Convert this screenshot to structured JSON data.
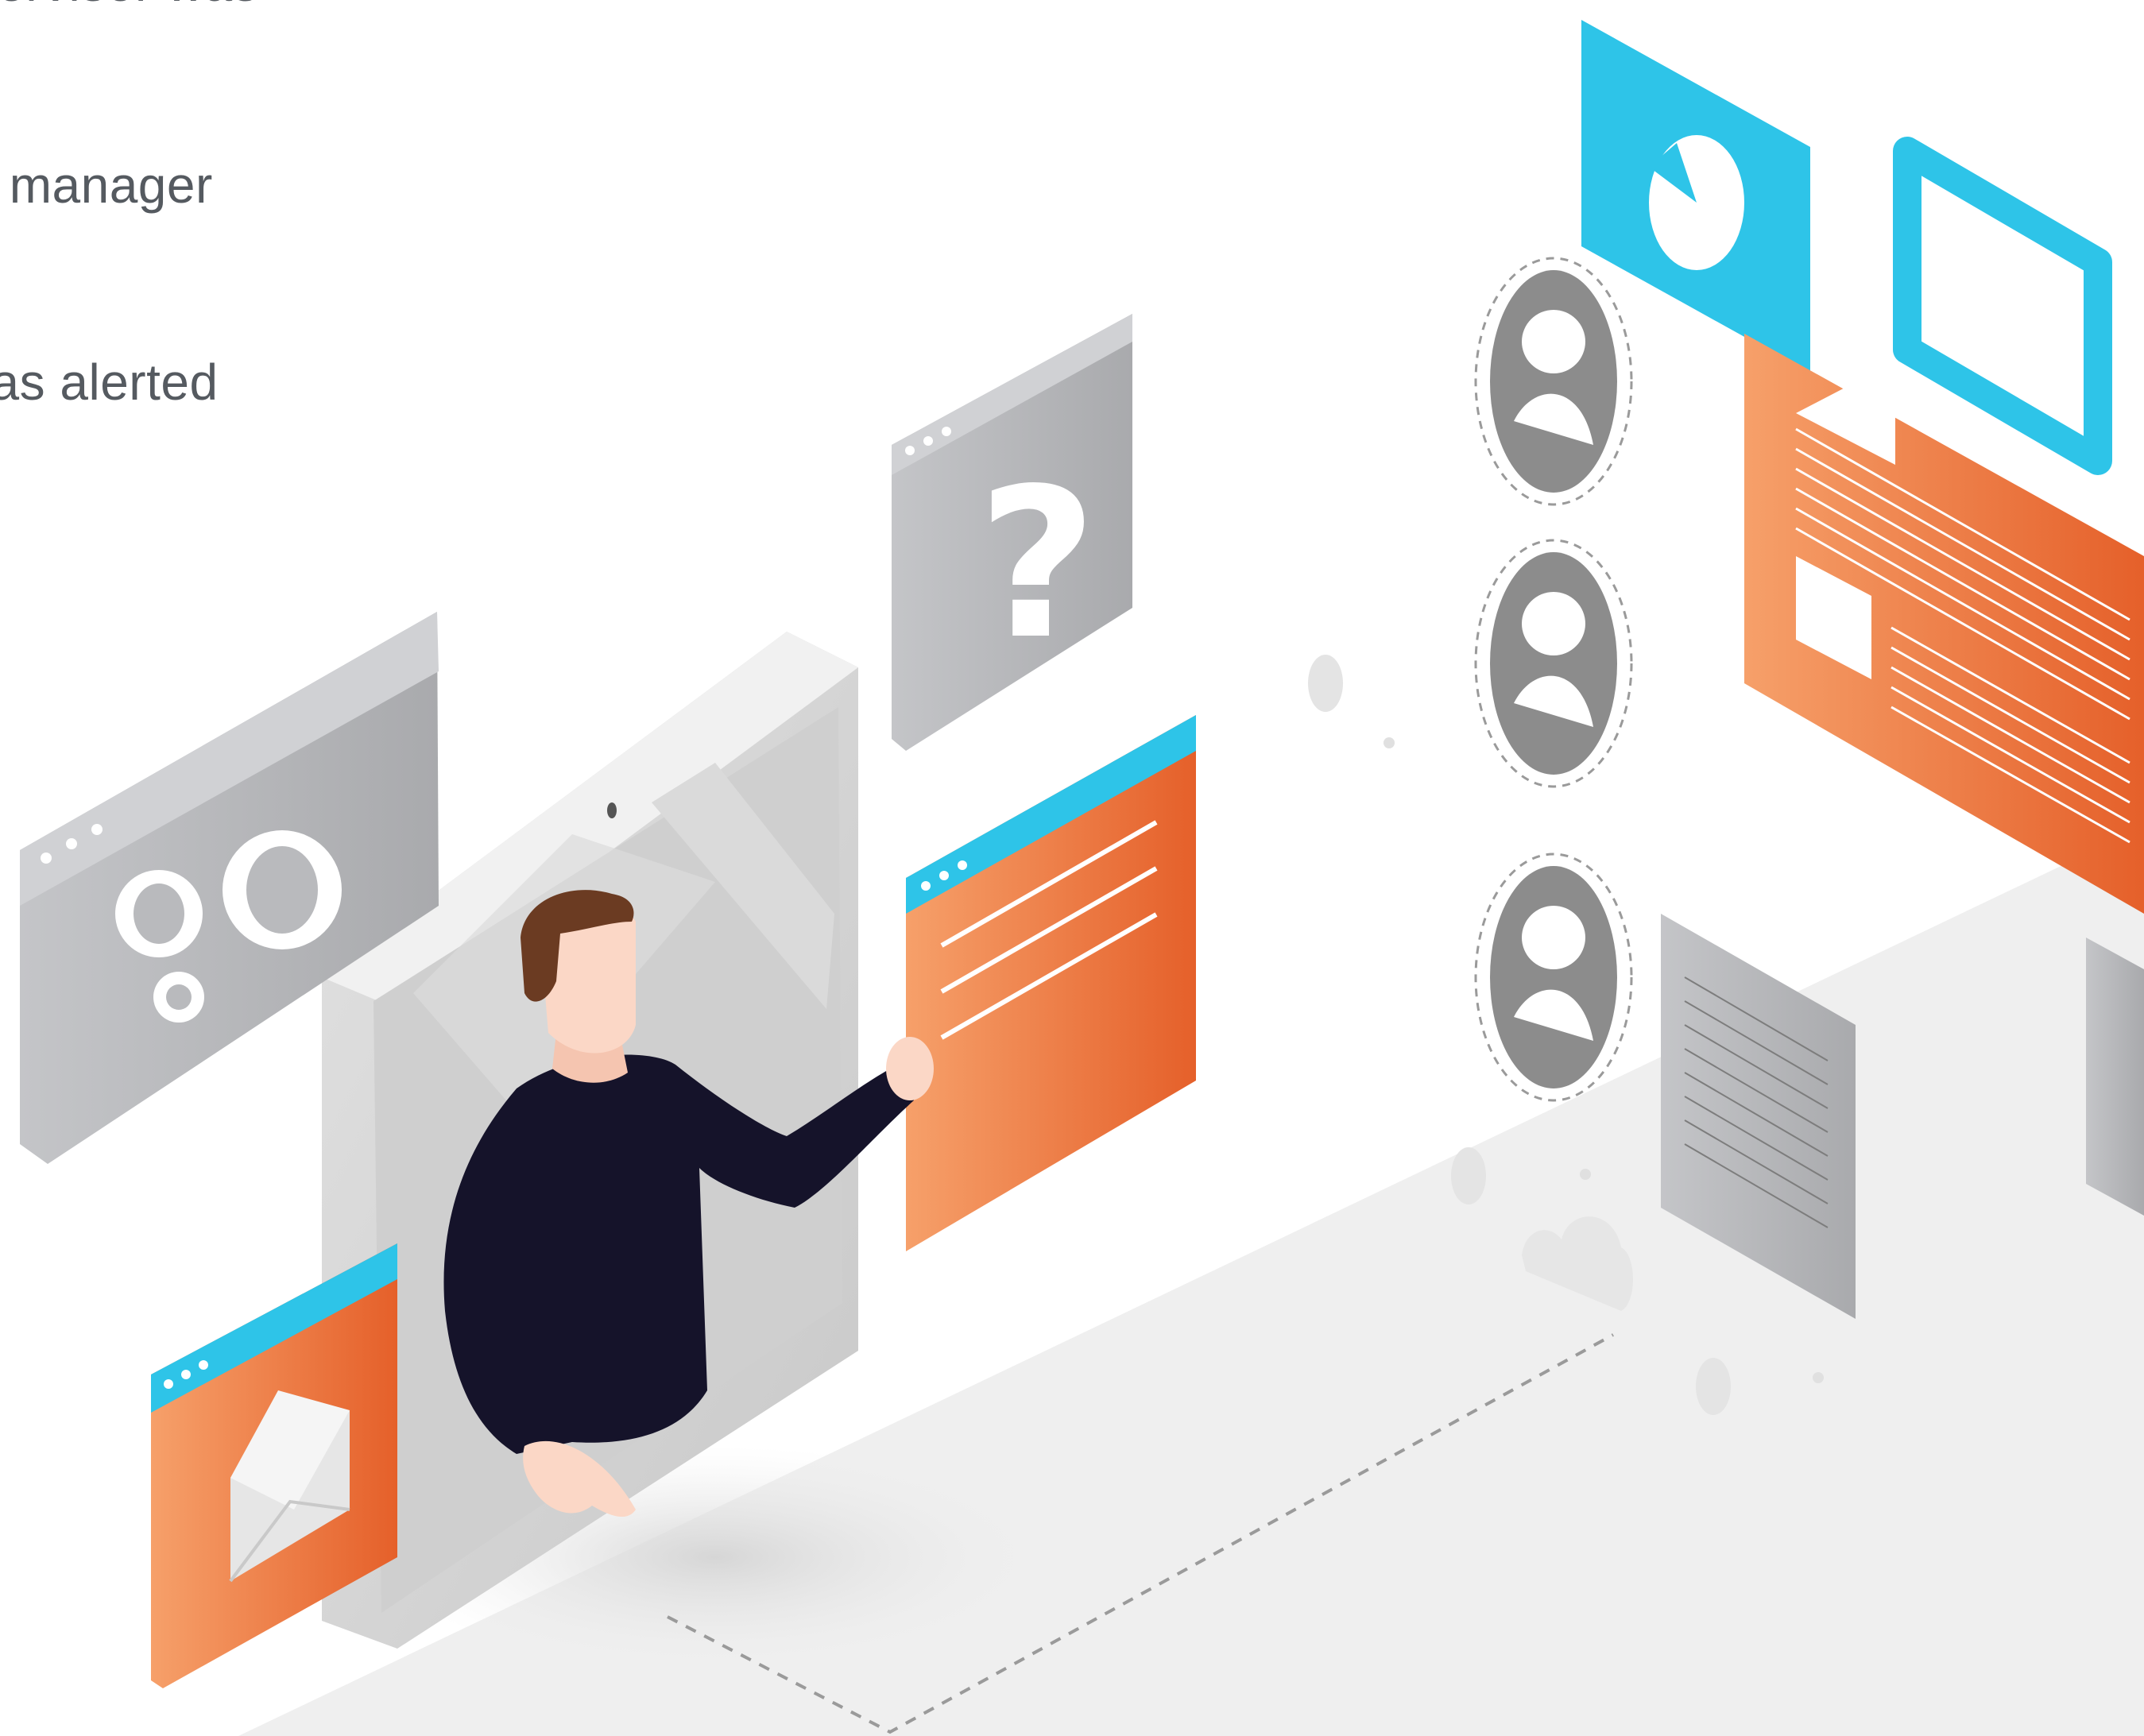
{
  "text_lines": [
    "pervisor was",
    "ions manager",
    "vas alerted"
  ],
  "colors": {
    "orange_light": "#f49a64",
    "orange_dark": "#e8642c",
    "blue": "#2ec4e8",
    "grey_panel": "#b3b4b7",
    "grey_dark": "#8c8c8c",
    "floor": "#efefef",
    "shirt": "#15132a",
    "skin": "#fbd7c6",
    "hair": "#6b3b22"
  },
  "icons": [
    "gears-icon",
    "question-mark-icon",
    "envelope-icon",
    "user-avatar-icon",
    "pie-chart-icon",
    "cloud-icon"
  ]
}
